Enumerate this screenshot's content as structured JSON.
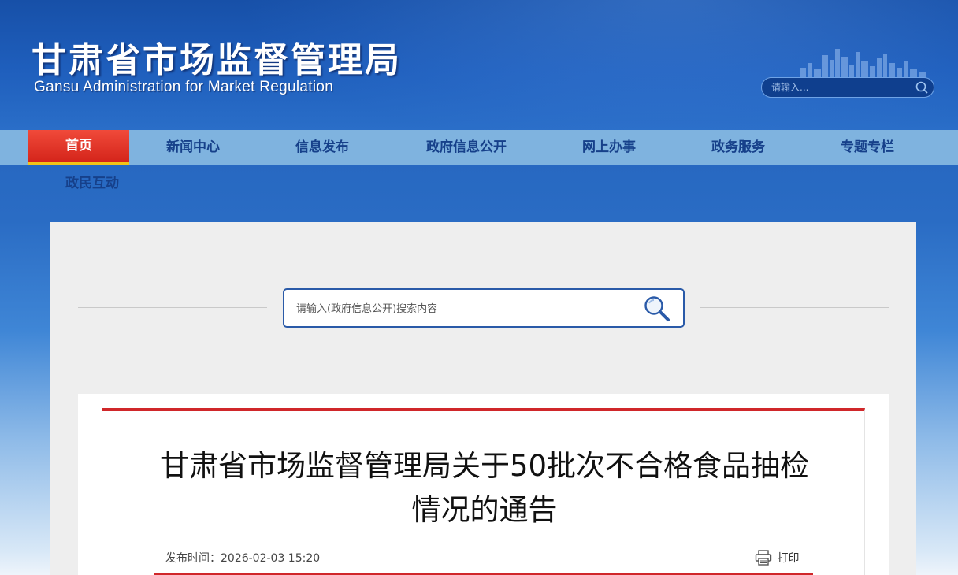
{
  "header": {
    "title_cn": "甘肃省市场监督管理局",
    "title_en": "Gansu Administration for Market Regulation",
    "search_placeholder": "请输入..."
  },
  "nav": {
    "items": [
      {
        "label": "首页",
        "active": true
      },
      {
        "label": "新闻中心"
      },
      {
        "label": "信息发布"
      },
      {
        "label": "政府信息公开"
      },
      {
        "label": "网上办事"
      },
      {
        "label": "政务服务"
      },
      {
        "label": "专题专栏"
      },
      {
        "label": "政民互动"
      }
    ]
  },
  "main": {
    "search_placeholder": "请输入(政府信息公开)搜索内容"
  },
  "article": {
    "title": "甘肃省市场监督管理局关于50批次不合格食品抽检情况的通告",
    "pubtime": "发布时间：2026-02-03 15:20",
    "print_label": "打印"
  },
  "colors": {
    "header_blue": "#1f5fbd",
    "nav_bg": "#7fb3df",
    "nav_text": "#16408a",
    "active_red": "#d4241a",
    "active_underline": "#f2c318",
    "article_rule": "#d0272a"
  }
}
